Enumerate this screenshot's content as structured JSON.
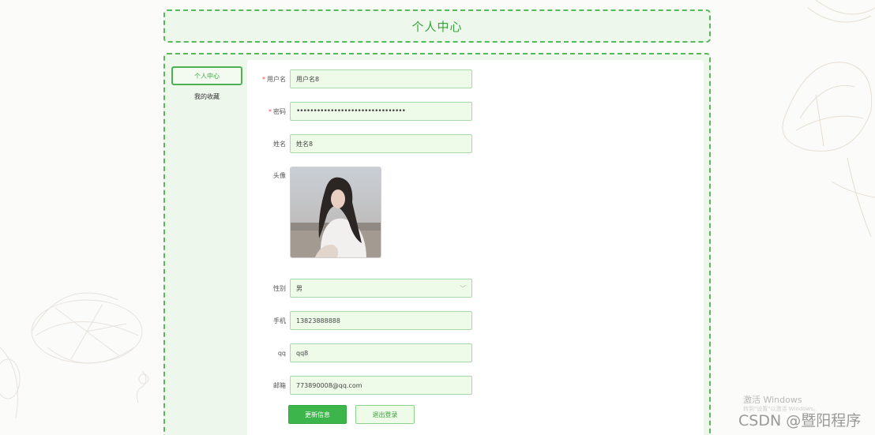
{
  "header": {
    "title": "个人中心"
  },
  "sidebar": {
    "items": [
      {
        "label": "个人中心",
        "active": true
      },
      {
        "label": "我的收藏",
        "active": false
      }
    ]
  },
  "form": {
    "username": {
      "label": "用户名",
      "required": true,
      "value": "用户名8"
    },
    "password": {
      "label": "密码",
      "required": true,
      "value": "••••••••••••••••••••••••••••••••"
    },
    "name": {
      "label": "姓名",
      "value": "姓名8"
    },
    "avatar": {
      "label": "头像"
    },
    "gender": {
      "label": "性别",
      "value": "男"
    },
    "phone": {
      "label": "手机",
      "value": "13823888888"
    },
    "qq": {
      "label": "qq",
      "value": "qq8"
    },
    "email": {
      "label": "邮箱",
      "value": "773890008@qq.com"
    }
  },
  "buttons": {
    "update": "更新信息",
    "logout": "退出登录"
  },
  "watermarks": {
    "activate": "激活 Windows",
    "activate_hint": "转到\"设置\"以激活 Windows。",
    "csdn": "CSDN @暨阳程序"
  },
  "colors": {
    "accent": "#3aa33e",
    "border": "#57b85a",
    "field_bg": "#eefbe9",
    "required": "#e04b4b"
  }
}
